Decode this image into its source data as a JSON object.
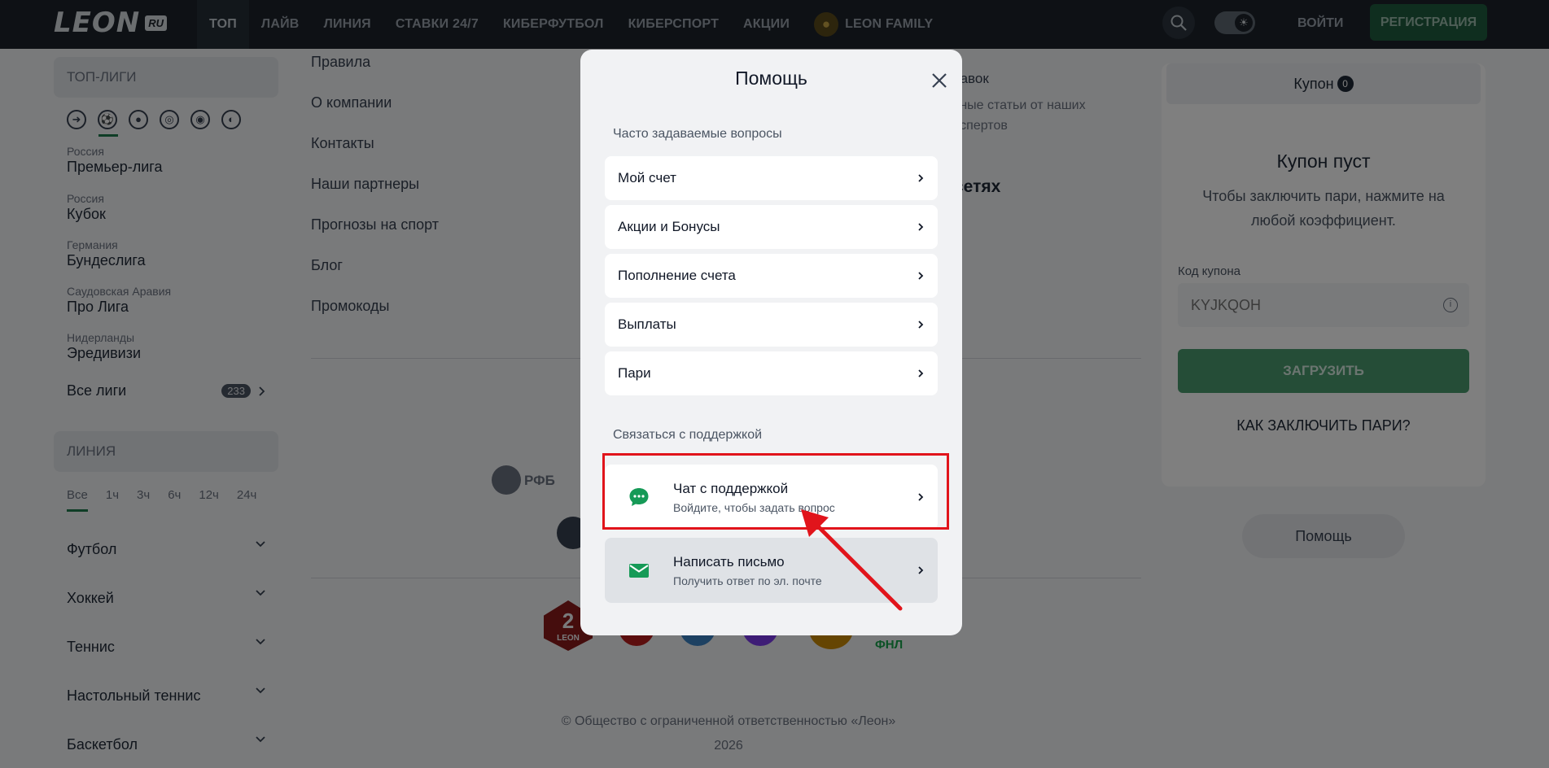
{
  "header": {
    "logo_text": "LEON",
    "logo_suffix": "RU",
    "nav": [
      {
        "label": "ТОП",
        "active": true
      },
      {
        "label": "ЛАЙВ"
      },
      {
        "label": "ЛИНИЯ"
      },
      {
        "label": "СТАВКИ 24/7"
      },
      {
        "label": "КИБЕРФУТБОЛ"
      },
      {
        "label": "КИБЕРСПОРТ"
      },
      {
        "label": "АКЦИИ"
      },
      {
        "label": "LEON FAMILY"
      }
    ],
    "login_label": "ВОЙТИ",
    "register_label": "РЕГИСТРАЦИЯ",
    "theme_icon": "sun-icon"
  },
  "sidebar": {
    "top_leagues_title": "ТОП-ЛИГИ",
    "leagues": [
      {
        "country": "Россия",
        "name": "Премьер-лига"
      },
      {
        "country": "Россия",
        "name": "Кубок"
      },
      {
        "country": "Германия",
        "name": "Бундеслига"
      },
      {
        "country": "Саудовская Аравия",
        "name": "Про Лига"
      },
      {
        "country": "Нидерланды",
        "name": "Эредивизи"
      }
    ],
    "all_leagues_label": "Все лиги",
    "all_leagues_count": "233",
    "line_title": "ЛИНИЯ",
    "time_tabs": [
      "Все",
      "1ч",
      "3ч",
      "6ч",
      "12ч",
      "24ч"
    ],
    "sports": [
      "Футбол",
      "Хоккей",
      "Теннис",
      "Настольный теннис",
      "Баскетбол"
    ]
  },
  "footer": {
    "links": [
      "Правила",
      "О компании",
      "Контакты",
      "Наши партнеры",
      "Прогнозы на спорт",
      "Блог",
      "Промокоды"
    ],
    "partial_stavok": "тавок",
    "partial_articles_1": "зные статьи от наших",
    "partial_articles_2": "кспертов",
    "partial_networks": "сетях",
    "rfb_label": "РФБ",
    "fnl_label": "ФНЛ",
    "leon_badge_label": "LEON",
    "leon_badge_num": "2",
    "copyright": "© Общество с ограниченной ответственностью «Леон»",
    "year": "2026"
  },
  "coupon": {
    "tab_label": "Купон",
    "tab_count": "0",
    "empty_title": "Купон пуст",
    "empty_text": "Чтобы заключить пари, нажмите на любой коэффициент.",
    "code_label": "Код купона",
    "code_placeholder": "KYJKQOH",
    "load_label": "ЗАГРУЗИТЬ",
    "how_label": "КАК ЗАКЛЮЧИТЬ ПАРИ?",
    "help_label": "Помощь"
  },
  "modal": {
    "title": "Помощь",
    "faq_title": "Часто задаваемые вопросы",
    "faq_items": [
      "Мой счет",
      "Акции и Бонусы",
      "Пополнение счета",
      "Выплаты",
      "Пари"
    ],
    "support_title": "Связаться с поддержкой",
    "chat": {
      "title": "Чат с поддержкой",
      "subtitle": "Войдите, чтобы задать вопрос"
    },
    "email": {
      "title": "Написать письмо",
      "subtitle": "Получить ответ по эл. почте"
    }
  },
  "colors": {
    "accent_green": "#1f7a4d",
    "support_icon_green": "#169a57",
    "highlight_red": "#e1141b"
  }
}
